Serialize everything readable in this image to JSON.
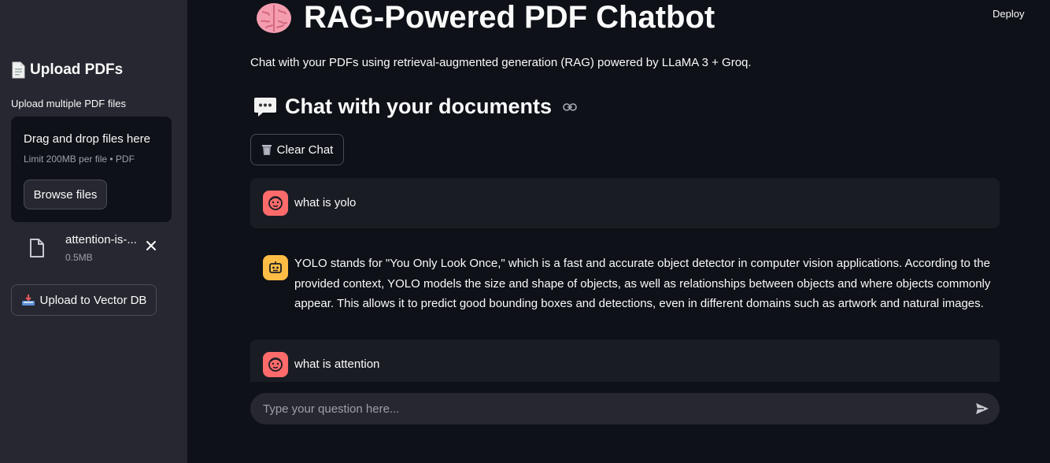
{
  "deploy_label": "Deploy",
  "sidebar": {
    "title": "Upload PDFs",
    "title_icon": "page-document-icon",
    "uploader_label": "Upload multiple PDF files",
    "dropzone": {
      "title": "Drag and drop files here",
      "limit": "Limit 200MB per file • PDF",
      "browse_label": "Browse files"
    },
    "files": [
      {
        "name": "attention-is-...",
        "size": "0.5MB"
      }
    ],
    "upload_button": {
      "icon": "inbox-tray-icon",
      "label": "Upload to Vector DB"
    }
  },
  "main": {
    "title": "RAG-Powered PDF Chatbot",
    "title_icon": "brain-icon",
    "subtitle": "Chat with your PDFs using retrieval-augmented generation (RAG) powered by LLaMA 3 + Groq.",
    "section_title": "Chat with your documents",
    "section_icon": "speech-bubble-icon",
    "clear_button": {
      "icon": "wastebasket-icon",
      "label": "Clear Chat"
    },
    "messages": [
      {
        "role": "user",
        "text": "what is yolo"
      },
      {
        "role": "assistant",
        "text": "YOLO stands for \"You Only Look Once,\" which is a fast and accurate object detector in computer vision applications. According to the provided context, YOLO models the size and shape of objects, as well as relationships between objects and where objects commonly appear. This allows it to predict good bounding boxes and detections, even in different domains such as artwork and natural images."
      },
      {
        "role": "user",
        "text": "what is attention"
      }
    ],
    "chat_input": {
      "placeholder": "Type your question here..."
    }
  },
  "colors": {
    "background": "#0e1117",
    "sidebar": "#262730",
    "user_avatar": "#ff6b6b",
    "assistant_avatar": "#ffbd45"
  }
}
